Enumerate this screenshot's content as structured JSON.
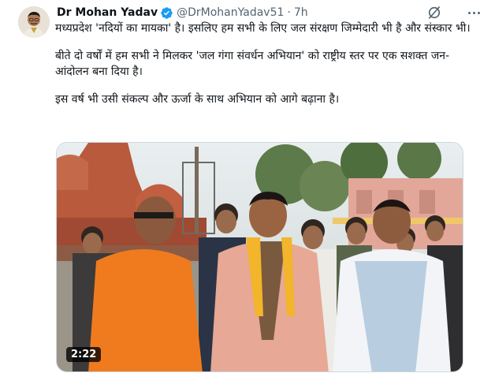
{
  "author": {
    "display_name": "Dr Mohan Yadav",
    "handle": "@DrMohanYadav51",
    "separator": "·",
    "time": "7h",
    "verified": true
  },
  "tweet": {
    "paragraphs": [
      "मध्यप्रदेश 'नदियों का मायका' है। इसलिए हम सभी के लिए जल संरक्षण जिम्मेदारी भी है और संस्कार भी।",
      "बीते दो वर्षों में हम सभी ने मिलकर 'जल गंगा संवर्धन अभियान' को राष्ट्रीय स्तर पर एक सशक्त जन-आंदोलन बना दिया है।",
      "इस वर्ष भी उसी संकल्प और ऊर्जा के साथ अभियान को आगे बढ़ाना है।"
    ]
  },
  "media": {
    "type": "video",
    "duration": "2:22"
  },
  "icons": {
    "verified": "verified-badge-icon",
    "grok": "grok-icon",
    "more": "more-options-icon"
  },
  "colors": {
    "verified": "#1d9bf0",
    "secondary_text": "#536471"
  }
}
